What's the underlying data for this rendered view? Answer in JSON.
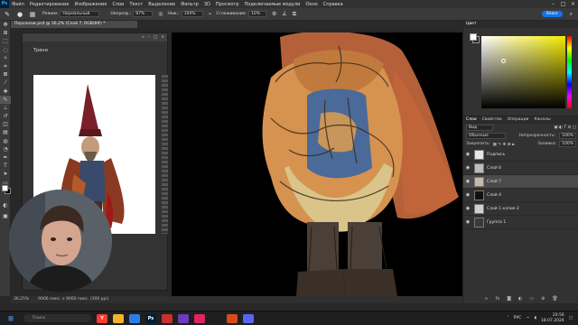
{
  "menu": {
    "logo": "Ps",
    "items": [
      "Файл",
      "Редактирование",
      "Изображение",
      "Слои",
      "Текст",
      "Выделение",
      "Фильтр",
      "3D",
      "Просмотр",
      "Подключаемые модули",
      "Окно",
      "Справка"
    ]
  },
  "options": {
    "mode_label": "Режим:",
    "mode_value": "Нормальный",
    "opacity_label": "Непрозр.:",
    "opacity_value": "87%",
    "pressure_label": "Наж.:",
    "pressure_value": "100%",
    "smoothing_label": "Сглаживание:",
    "smoothing_value": "10%",
    "share_label": "Share"
  },
  "document": {
    "tab_title": "Персонаж.psd @ 36,2% (Слой 7, RGB/8#) *"
  },
  "reference_panel": {
    "title": "Трени"
  },
  "status": {
    "zoom": "36,25%",
    "size": "9006 пикс. x 9060 пикс. (300 ppi)"
  },
  "color_panel": {
    "tab_color": "Цвет",
    "marker_color": "#ffffff"
  },
  "layers_panel": {
    "tabs": [
      "Слои",
      "Свойства",
      "Операции",
      "Каналы"
    ],
    "search": "Вид",
    "blend_mode": "Обычные",
    "opacity_label": "Непрозрачность:",
    "opacity_value": "100%",
    "lock_label": "Закрепить:",
    "fill_label": "Заливка:",
    "fill_value": "100%",
    "layers": [
      {
        "name": "Подпись",
        "visible": true,
        "selected": false,
        "thumb": "#e6e6e6"
      },
      {
        "name": "Слой 6",
        "visible": true,
        "selected": false,
        "thumb": "#bcbcbc"
      },
      {
        "name": "Слой 7",
        "visible": true,
        "selected": true,
        "thumb": "#c8b8a8"
      },
      {
        "name": "Слой 4",
        "visible": true,
        "selected": false,
        "thumb": "#111111"
      },
      {
        "name": "Слой 1 копия 2",
        "visible": true,
        "selected": false,
        "thumb": "#d0d0d0"
      },
      {
        "name": "Группа 1",
        "visible": true,
        "selected": false,
        "thumb": "#3a3a3a"
      }
    ]
  },
  "taskbar": {
    "search_placeholder": "Поиск",
    "lang": "РУС",
    "time": "20:56",
    "date": "18.07.2024",
    "icons": [
      {
        "label": "Y",
        "color": "#ff3b30"
      },
      {
        "label": "",
        "color": "#f2b32a"
      },
      {
        "label": "",
        "color": "#2b7de9"
      },
      {
        "label": "Ps",
        "color": "#001e36"
      },
      {
        "label": "",
        "color": "#c9302c"
      },
      {
        "label": "",
        "color": "#6a3cc0"
      },
      {
        "label": "",
        "color": "#e0245e"
      },
      {
        "label": "",
        "color": "#1e1e1e"
      },
      {
        "label": "",
        "color": "#d84a1b"
      },
      {
        "label": "",
        "color": "#5865f2"
      }
    ]
  }
}
